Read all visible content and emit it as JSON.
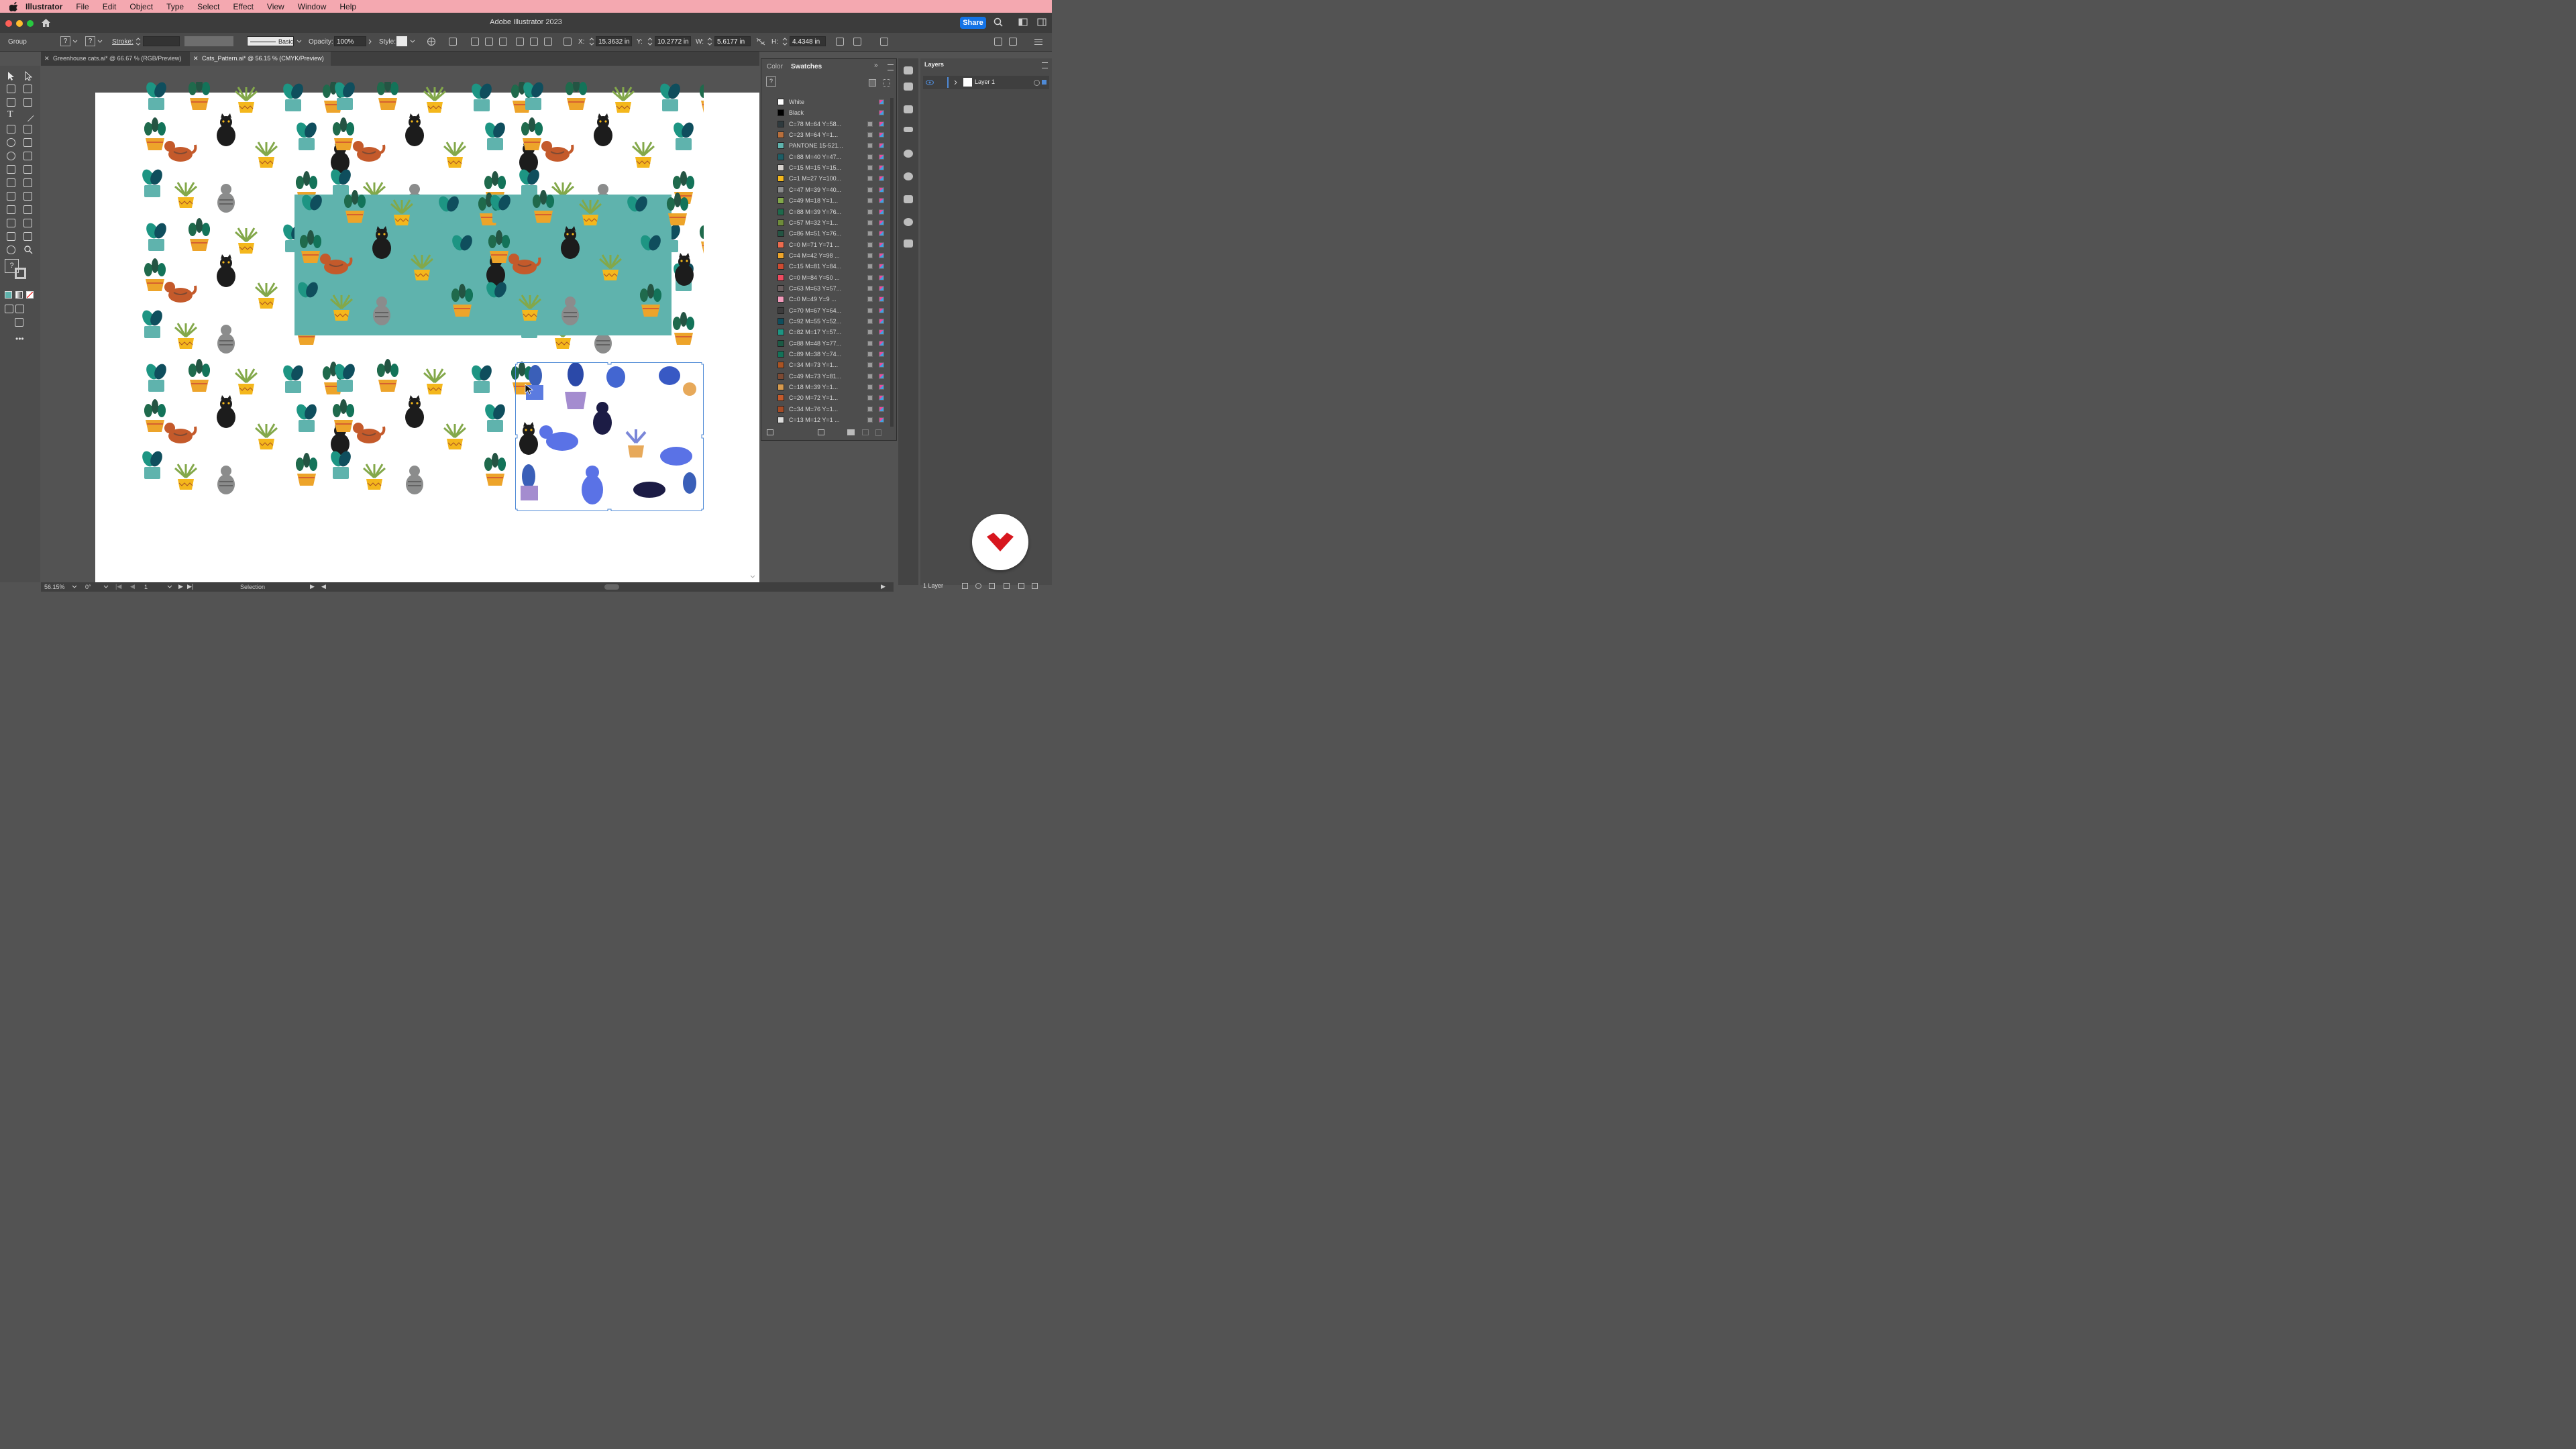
{
  "menubar": {
    "app_name": "Illustrator",
    "items": [
      "File",
      "Edit",
      "Object",
      "Type",
      "Select",
      "Effect",
      "View",
      "Window",
      "Help"
    ]
  },
  "window": {
    "title": "Adobe Illustrator 2023",
    "share_label": "Share"
  },
  "control_bar": {
    "selection_type": "Group",
    "stroke_label": "Stroke:",
    "brush_label": "Basic",
    "opacity_label": "Opacity:",
    "opacity_value": "100%",
    "style_label": "Style:",
    "x_label": "X:",
    "x_value": "15.3632 in",
    "y_label": "Y:",
    "y_value": "10.2772 in",
    "w_label": "W:",
    "w_value": "5.6177 in",
    "h_label": "H:",
    "h_value": "4.4348 in"
  },
  "tabs": [
    {
      "label": "Greenhouse cats.ai* @ 66.67 % (RGB/Preview)"
    },
    {
      "label": "Cats_Pattern.ai* @ 56.15 % (CMYK/Preview)"
    }
  ],
  "swatches_panel": {
    "tab_color": "Color",
    "tab_swatches": "Swatches",
    "items": [
      {
        "name": "White",
        "color": "#ffffff"
      },
      {
        "name": "Black",
        "color": "#000000"
      },
      {
        "name": "C=78 M=64 Y=58...",
        "color": "#2f3a3e"
      },
      {
        "name": "C=23 M=64 Y=1...",
        "color": "#b86f3c"
      },
      {
        "name": "PANTONE 15-521...",
        "color": "#5fb3ad"
      },
      {
        "name": "C=88 M=40 Y=47...",
        "color": "#1d5e66"
      },
      {
        "name": "C=15 M=15 Y=15...",
        "color": "#d7d2cd"
      },
      {
        "name": "C=1 M=27 Y=100...",
        "color": "#f4b71c"
      },
      {
        "name": "C=47 M=39 Y=40...",
        "color": "#8b8c8c"
      },
      {
        "name": "C=49 M=18 Y=1...",
        "color": "#83a84a"
      },
      {
        "name": "C=88 M=39 Y=76...",
        "color": "#1f6a4c"
      },
      {
        "name": "C=57 M=32 Y=1...",
        "color": "#6f8c3a"
      },
      {
        "name": "C=86 M=51 Y=76...",
        "color": "#245443"
      },
      {
        "name": "C=0 M=71 Y=71 ...",
        "color": "#ec6b4e"
      },
      {
        "name": "C=4 M=42 Y=98 ...",
        "color": "#eda42a"
      },
      {
        "name": "C=15 M=81 Y=84...",
        "color": "#cf4b31"
      },
      {
        "name": "C=0 M=84 Y=50 ...",
        "color": "#ee4a5f"
      },
      {
        "name": "C=63 M=63 Y=57...",
        "color": "#6a5e5f"
      },
      {
        "name": "C=0 M=49 Y=9 ...",
        "color": "#f39abb"
      },
      {
        "name": "C=70 M=67 Y=64...",
        "color": "#3c3b3c"
      },
      {
        "name": "C=92 M=55 Y=52...",
        "color": "#0f4e5d"
      },
      {
        "name": "C=82 M=17 Y=57...",
        "color": "#1d9583"
      },
      {
        "name": "C=88 M=48 Y=77...",
        "color": "#1c5a45"
      },
      {
        "name": "C=89 M=38 Y=74...",
        "color": "#137359"
      },
      {
        "name": "C=34 M=73 Y=1...",
        "color": "#a95323"
      },
      {
        "name": "C=49 M=73 Y=81...",
        "color": "#7e4a33"
      },
      {
        "name": "C=18 M=39 Y=1...",
        "color": "#d79a4d"
      },
      {
        "name": "C=20 M=72 Y=1...",
        "color": "#c45a2b"
      },
      {
        "name": "C=34 M=76 Y=1...",
        "color": "#a64b25"
      },
      {
        "name": "C=13 M=12 Y=1 ...",
        "color": "#dcdcdb"
      }
    ]
  },
  "layers_panel": {
    "title": "Layers",
    "layer_name": "Layer 1",
    "footer_count": "1 Layer"
  },
  "status_bar": {
    "zoom": "56.15%",
    "rotation": "0°",
    "artboard_number": "1",
    "tool_name": "Selection"
  },
  "colors": {
    "accent": "#1473e6",
    "menubar_bg": "#f4a8b0",
    "teal_rect": "#5fb3ad",
    "selection_blue": "#4f8ad6",
    "logo_red": "#d7161e"
  }
}
